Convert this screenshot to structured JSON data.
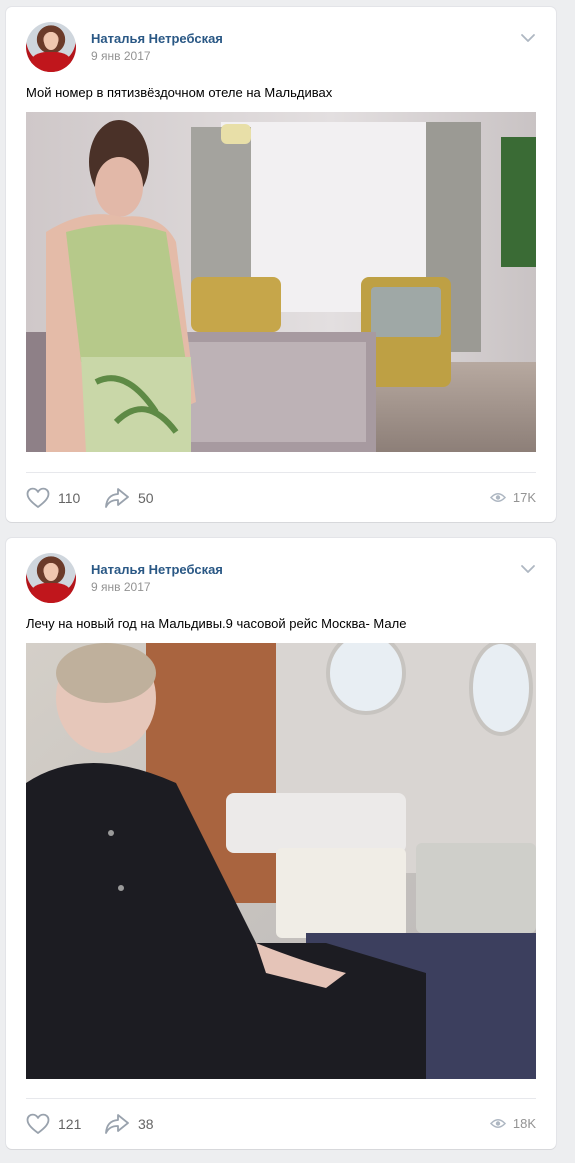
{
  "posts": [
    {
      "author": "Наталья Нетребская",
      "date": "9 янв 2017",
      "text": "Мой номер в пятизвёздочном отеле на Мальдивах",
      "likes": "110",
      "shares": "50",
      "views": "17K"
    },
    {
      "author": "Наталья Нетребская",
      "date": "9 янв 2017",
      "text": "Лечу на новый год на Мальдивы.9 часовой рейс Москва- Мале",
      "likes": "121",
      "shares": "38",
      "views": "18K"
    }
  ],
  "icons": {
    "menu": "chevron-down-icon",
    "like": "heart-icon",
    "share": "share-arrow-icon",
    "views": "eye-icon"
  },
  "colors": {
    "author_link": "#2a5885",
    "meta_gray": "#939393",
    "action_gray": "#656565",
    "background": "#edeef0"
  }
}
